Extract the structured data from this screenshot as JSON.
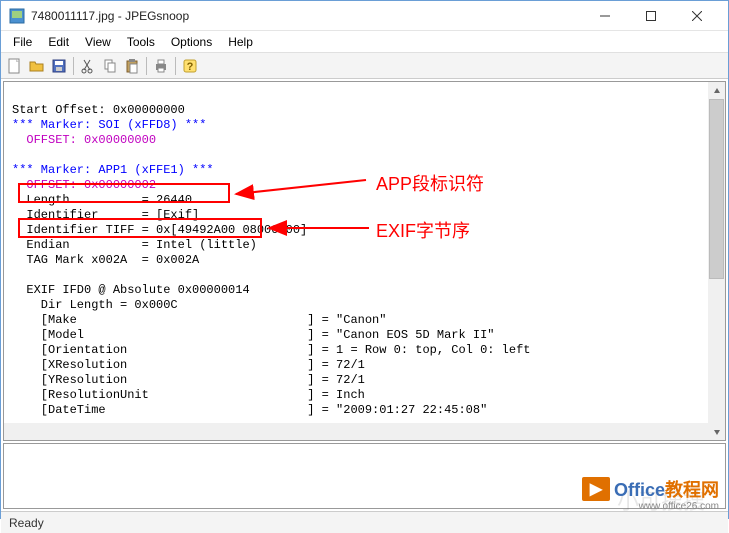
{
  "title": "7480011117.jpg - JPEGsnoop",
  "menu": {
    "file": "File",
    "edit": "Edit",
    "view": "View",
    "tools": "Tools",
    "options": "Options",
    "help": "Help"
  },
  "toolbar_icons": {
    "new": "new-icon",
    "open": "open-icon",
    "save": "save-icon",
    "cut": "cut-icon",
    "copy": "copy-icon",
    "paste": "paste-icon",
    "print": "print-icon",
    "help": "help-icon"
  },
  "labels": {
    "app_seg": "APP段标识符",
    "exif_endian": "EXIF字节序"
  },
  "text": {
    "l1": "Start Offset: 0x00000000",
    "l2": "*** Marker: SOI (xFFD8) ***",
    "l3": "  OFFSET: 0x00000000",
    "l4": " ",
    "l5": "*** Marker: APP1 (xFFE1) ***",
    "l6": "  OFFSET: 0x00000002",
    "l7": "  Length          = 26440",
    "l8": "  Identifier      = [Exif]",
    "l9": "  Identifier TIFF = 0x[49492A00 08000000]",
    "l10": "  Endian          = Intel (little)",
    "l11": "  TAG Mark x002A  = 0x002A",
    "l12": " ",
    "l13": "  EXIF IFD0 @ Absolute 0x00000014",
    "l14": "    Dir Length = 0x000C",
    "l15": "    [Make                                ] = \"Canon\"",
    "l16": "    [Model                               ] = \"Canon EOS 5D Mark II\"",
    "l17": "    [Orientation                         ] = 1 = Row 0: top, Col 0: left",
    "l18": "    [XResolution                         ] = 72/1",
    "l19": "    [YResolution                         ] = 72/1",
    "l20": "    [ResolutionUnit                      ] = Inch",
    "l21": "    [DateTime                            ] = \"2009:01:27 22:45:08\""
  },
  "status": "Ready",
  "logo": {
    "office": "Office",
    "tutorial": "教程网",
    "url": "www.office26.com"
  },
  "watermark": "小可搜搜"
}
